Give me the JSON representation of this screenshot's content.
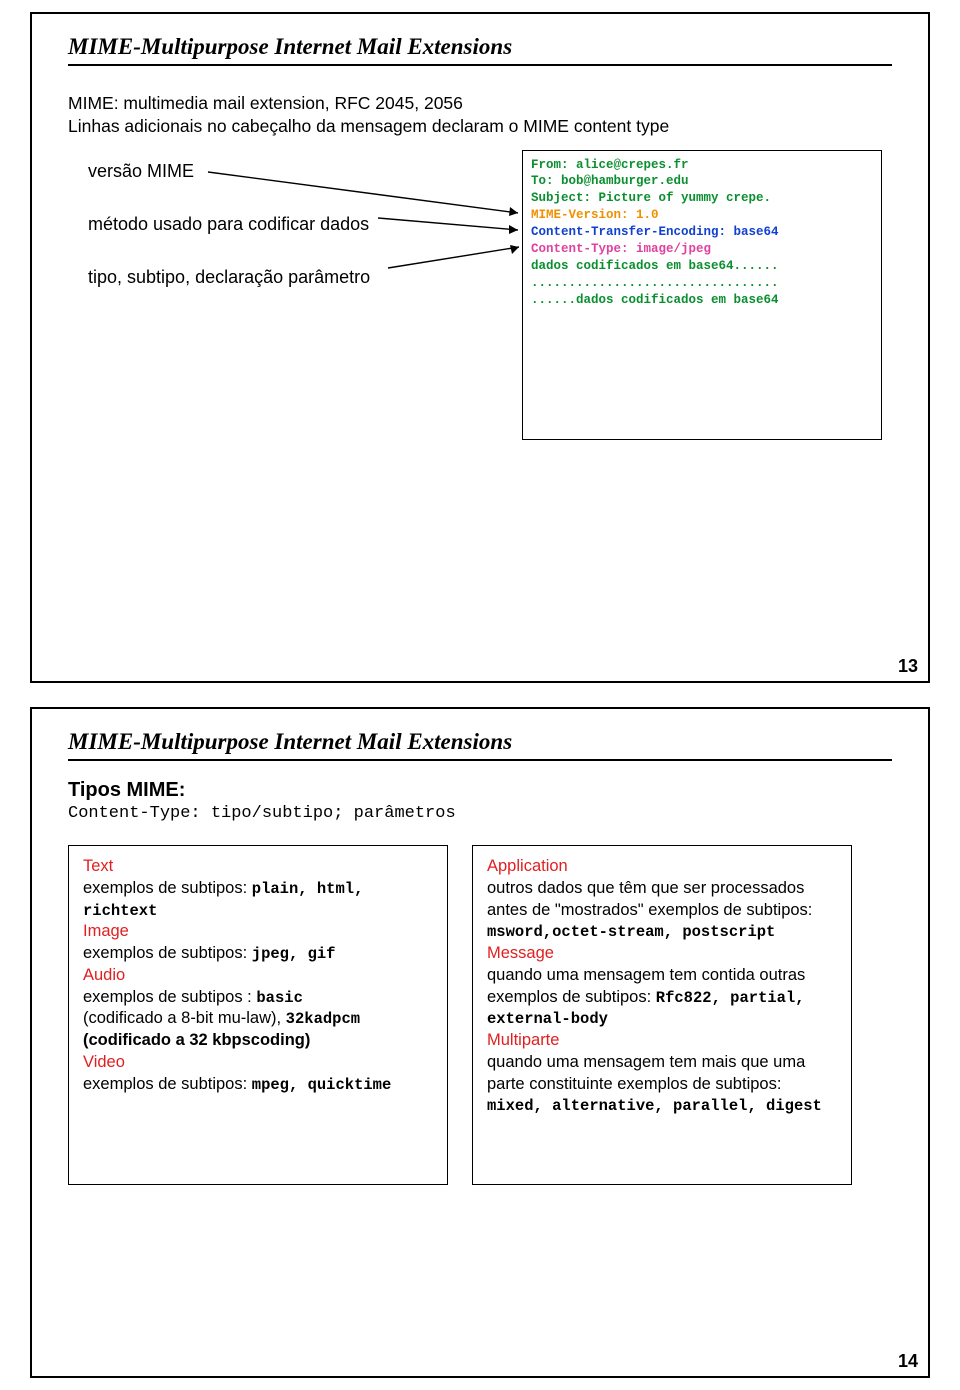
{
  "slide13": {
    "title": "MIME-Multipurpose Internet Mail Extensions",
    "intro_line1": "MIME: multimedia mail extension, RFC 2045, 2056",
    "intro_line2": "Linhas adicionais no cabeçalho da mensagem declaram o MIME content type",
    "label1": "versão MIME",
    "label2": "método usado para codificar dados",
    "label3": "tipo, subtipo, declaração parâmetro",
    "code": {
      "from": "From: alice@crepes.fr",
      "to": "To: bob@hamburger.edu",
      "subject": "Subject: Picture of yummy crepe.",
      "version": "MIME-Version: 1.0",
      "encoding": "Content-Transfer-Encoding: base64",
      "ctype": "Content-Type: image/jpeg",
      "data1": "dados codificados em base64......",
      "data2": ".................................",
      "data3": "......dados codificados em base64"
    },
    "pagenum": "13"
  },
  "slide14": {
    "title": "MIME-Multipurpose Internet Mail Extensions",
    "heading": "Tipos MIME:",
    "sub": "Content-Type: tipo/subtipo; parâmetros",
    "left": {
      "text": "Text",
      "text_ex_a": "exemplos de subtipos: ",
      "text_ex_b": "plain, html, richtext",
      "image": "Image",
      "image_ex_a": "exemplos de subtipos: ",
      "image_ex_b": "jpeg, gif",
      "audio": "Audio",
      "audio_ex_a": "exemplos de subtipos : ",
      "audio_ex_b": "basic",
      "audio_ex_c": "(codificado a 8-bit mu-law), ",
      "audio_ex_d": "32kadpcm",
      "audio_ex_e": "(codificado a 32 kbpscoding)",
      "video": "Video",
      "video_ex_a": "exemplos de subtipos: ",
      "video_ex_b": "mpeg, quicktime"
    },
    "right": {
      "app": "Application",
      "app_ex_a": "outros dados que têm que ser processados antes de \"mostrados\" exemplos de subtipos: ",
      "app_ex_b": "msword,octet-stream, postscript",
      "msg": "Message",
      "msg_ex_a": "quando uma mensagem tem contida outras exemplos de subtipos: ",
      "msg_ex_b": "Rfc822, partial, external-body",
      "mp": "Multiparte",
      "mp_ex_a": "quando uma mensagem tem mais que uma parte constituinte exemplos de subtipos: ",
      "mp_ex_b": "mixed, alternative, parallel, digest"
    },
    "pagenum": "14"
  }
}
